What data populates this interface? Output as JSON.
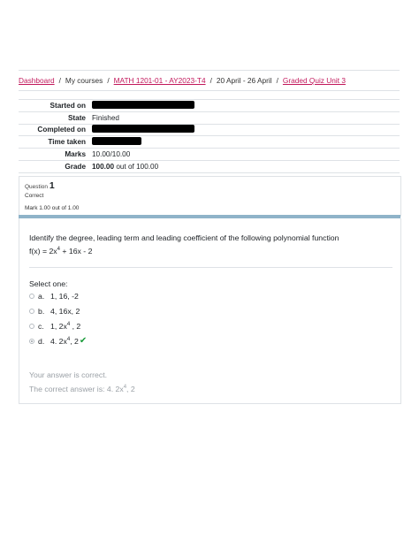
{
  "breadcrumb": {
    "items": [
      {
        "label": "Dashboard",
        "link": true
      },
      {
        "label": "My courses",
        "link": false
      },
      {
        "label": "MATH 1201-01 - AY2023-T4",
        "link": true
      },
      {
        "label": "20 April - 26 April",
        "link": false
      },
      {
        "label": "Graded Quiz Unit 3",
        "link": true
      }
    ],
    "separator": "/"
  },
  "summary": {
    "started_on_label": "Started on",
    "state_label": "State",
    "state_value": "Finished",
    "completed_on_label": "Completed on",
    "time_taken_label": "Time taken",
    "marks_label": "Marks",
    "marks_value": "10.00/10.00",
    "grade_label": "Grade",
    "grade_value_bold": "100.00",
    "grade_value_rest": " out of 100.00"
  },
  "question": {
    "number_label": "Question",
    "number": "1",
    "state": "Correct",
    "mark": "Mark 1.00 out of 1.00",
    "text": "Identify the degree, leading term and leading coefficient of the following polynomial function",
    "formula": {
      "prefix": "f(x) = 2x",
      "exp": "4",
      "suffix": " + 16x - 2"
    },
    "prompt": "Select one:",
    "options": [
      {
        "letter": "a.",
        "pre": "1, 16, -2",
        "exp": "",
        "post": ""
      },
      {
        "letter": "b.",
        "pre": "4, 16x, 2",
        "exp": "",
        "post": ""
      },
      {
        "letter": "c.",
        "pre": "1, 2x",
        "exp": "4",
        "post": " , 2"
      },
      {
        "letter": "d.",
        "pre": "4. 2x",
        "exp": "4",
        "post": ", 2"
      }
    ],
    "selected_option": "d.",
    "feedback_correct": "Your answer is correct.",
    "correct_answer": {
      "pre": "The correct answer is: 4. 2x",
      "exp": "4",
      "post": ", 2"
    }
  },
  "colors": {
    "link": "#c2185b",
    "check": "#1a9b3a",
    "accent_bar": "#8fb3c9"
  },
  "icons": {
    "correct": "check-icon"
  }
}
